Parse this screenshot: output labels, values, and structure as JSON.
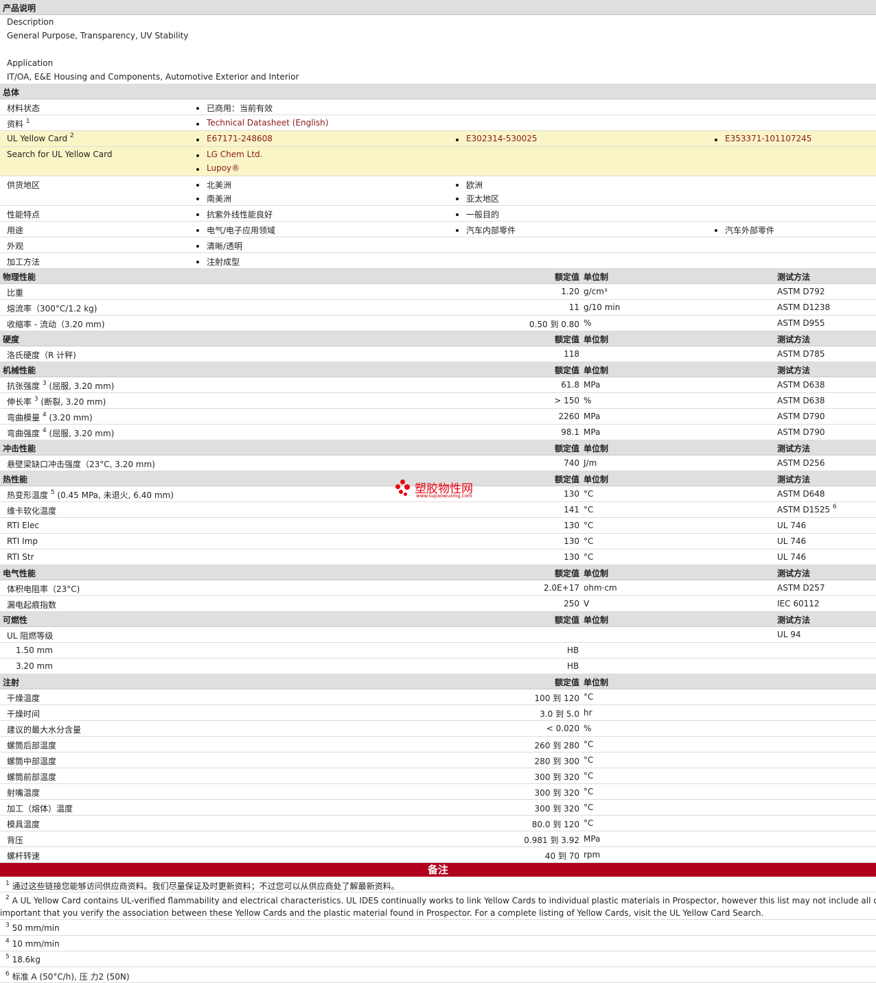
{
  "overview": {
    "title": "产品说明",
    "description_label": "Description",
    "description_text": "General Purpose, Transparency, UV Stability",
    "application_label": "Application",
    "application_text": "IT/OA, E&E Housing and Components, Automotive Exterior and Interior"
  },
  "general": {
    "title": "总体",
    "material_status_label": "材料状态",
    "material_status_value": "已商用：当前有效",
    "literature_label": "资料",
    "literature_sup": "1",
    "literature_link": "Technical Datasheet (English)",
    "ul_card_label": "UL Yellow Card",
    "ul_card_sup": "2",
    "ul_card_links": [
      "E67171-248608",
      "E302314-530025",
      "E353371-101107245"
    ],
    "search_label": "Search for UL Yellow Card",
    "search_links": [
      "LG Chem Ltd.",
      "Lupoy®"
    ],
    "availability_label": "供货地区",
    "availability": [
      "北美洲",
      "欧洲",
      "南美洲",
      "亚太地区"
    ],
    "features_label": "性能特点",
    "features": [
      "抗紫外线性能良好",
      "一般目的"
    ],
    "uses_label": "用途",
    "uses": [
      "电气/电子应用领域",
      "汽车内部零件",
      "汽车外部零件"
    ],
    "appearance_label": "外观",
    "appearance": "清晰/透明",
    "processing_label": "加工方法",
    "processing": "注射成型"
  },
  "headers": {
    "value": "额定值",
    "unit": "单位制",
    "method": "测试方法"
  },
  "physical": {
    "title": "物理性能",
    "rows": [
      {
        "label": "比重",
        "value": "1.20",
        "unit": "g/cm³",
        "method": "ASTM D792"
      },
      {
        "label": "熔流率（300°C/1.2 kg)",
        "value": "11",
        "unit": "g/10 min",
        "method": "ASTM D1238"
      },
      {
        "label": "收缩率 - 流动（3.20 mm)",
        "value": "0.50 到  0.80",
        "unit": "%",
        "method": "ASTM D955"
      }
    ]
  },
  "hardness": {
    "title": "硬度",
    "rows": [
      {
        "label": "洛氏硬度（R 计秤)",
        "value": "118",
        "unit": "",
        "method": "ASTM D785"
      }
    ]
  },
  "mechanical": {
    "title": "机械性能",
    "rows": [
      {
        "label": "抗张强度",
        "sup": "3",
        "suffix": "(屈服, 3.20 mm)",
        "value": "61.8",
        "unit": "MPa",
        "method": "ASTM D638"
      },
      {
        "label": "伸长率",
        "sup": "3",
        "suffix": "(断裂, 3.20 mm)",
        "value": "> 150",
        "unit": "%",
        "method": "ASTM D638"
      },
      {
        "label": "弯曲模量",
        "sup": "4",
        "suffix": "(3.20 mm)",
        "value": "2260",
        "unit": "MPa",
        "method": "ASTM D790"
      },
      {
        "label": "弯曲强度",
        "sup": "4",
        "suffix": "(屈服, 3.20 mm)",
        "value": "98.1",
        "unit": "MPa",
        "method": "ASTM D790"
      }
    ]
  },
  "impact": {
    "title": "冲击性能",
    "rows": [
      {
        "label": "悬壁梁缺口冲击强度（23°C, 3.20 mm)",
        "value": "740",
        "unit": "J/m",
        "method": "ASTM D256"
      }
    ]
  },
  "thermal": {
    "title": "热性能",
    "rows": [
      {
        "label": "热变形温度",
        "sup": "5",
        "suffix": "(0.45 MPa, 未退火, 6.40 mm)",
        "value": "130",
        "unit": "°C",
        "method": "ASTM D648"
      },
      {
        "label": "维卡软化温度",
        "value": "141",
        "unit": "°C",
        "method": "ASTM D1525",
        "method_sup": "6"
      },
      {
        "label": "RTI Elec",
        "value": "130",
        "unit": "°C",
        "method": "UL 746"
      },
      {
        "label": "RTI Imp",
        "value": "130",
        "unit": "°C",
        "method": "UL 746"
      },
      {
        "label": "RTI Str",
        "value": "130",
        "unit": "°C",
        "method": "UL 746"
      }
    ]
  },
  "electrical": {
    "title": "电气性能",
    "rows": [
      {
        "label": "体积电阻率（23°C)",
        "value": "2.0E+17",
        "unit": "ohm·cm",
        "method": "ASTM D257"
      },
      {
        "label": "漏电起痕指数",
        "value": "250",
        "unit": "V",
        "method": "IEC 60112"
      }
    ]
  },
  "flammability": {
    "title": "可燃性",
    "rating_label": "UL 阻燃等级",
    "rating_method": "UL 94",
    "rows": [
      {
        "label": "1.50 mm",
        "value": "HB"
      },
      {
        "label": "3.20 mm",
        "value": "HB"
      }
    ]
  },
  "injection": {
    "title": "注射",
    "rows": [
      {
        "label": "干燥温度",
        "value": "100 到  120",
        "unit": "°C"
      },
      {
        "label": "干燥时间",
        "value": "3.0 到  5.0",
        "unit": "hr"
      },
      {
        "label": "建议的最大水分含量",
        "value": "< 0.020",
        "unit": "%"
      },
      {
        "label": "螺筒后部温度",
        "value": "260 到  280",
        "unit": "°C"
      },
      {
        "label": "螺筒中部温度",
        "value": "280 到  300",
        "unit": "°C"
      },
      {
        "label": "螺筒前部温度",
        "value": "300 到  320",
        "unit": "°C"
      },
      {
        "label": "射嘴温度",
        "value": "300 到  320",
        "unit": "°C"
      },
      {
        "label": "加工（熔体）温度",
        "value": "300 到  320",
        "unit": "°C"
      },
      {
        "label": "模具温度",
        "value": "80.0 到  120",
        "unit": "°C"
      },
      {
        "label": "背压",
        "value": "0.981 到  3.92",
        "unit": "MPa"
      },
      {
        "label": "螺杆转速",
        "value": "40 到  70",
        "unit": "rpm"
      }
    ]
  },
  "notes": {
    "title": "备注",
    "items": [
      {
        "num": "1",
        "text": "通过这些链接您能够访问供应商资料。我们尽量保证及时更新资料；不过您可以从供应商处了解最新资料。"
      },
      {
        "num": "2",
        "text": "A UL Yellow Card contains UL-verified flammability and electrical characteristics. UL IDES continually works to link Yellow Cards to individual plastic materials in Prospector, however this list may not include all of the ap",
        "text2": "important that you verify the association between these Yellow Cards and the plastic material found in Prospector. For a complete listing of Yellow Cards, visit the UL Yellow Card Search."
      },
      {
        "num": "3",
        "text": "50 mm/min"
      },
      {
        "num": "4",
        "text": "10 mm/min"
      },
      {
        "num": "5",
        "text": "18.6kg"
      },
      {
        "num": "6",
        "text": "标准 A (50°C/h), 压 力2 (50N)"
      }
    ]
  },
  "watermark": {
    "text": "塑胶物性网",
    "url": "www.sujiaowuxing.com",
    "color": "#e8000d"
  },
  "colors": {
    "section_bg": "#dfdfdf",
    "highlight_bg": "#faf5c7",
    "link": "#8b1a1a",
    "notes_bar": "#b0001d"
  }
}
